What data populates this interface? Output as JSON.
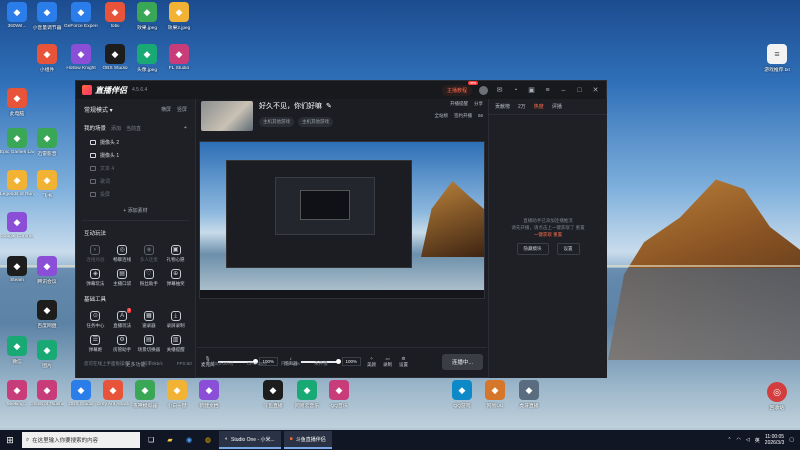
{
  "desktop": {
    "icons_left": [
      {
        "label": "360Wif..."
      },
      {
        "label": "此电脑"
      },
      {
        "label": "Epic Games Launcher"
      },
      {
        "label": "Legends of Runeterra"
      },
      {
        "label": "Google Chrome"
      },
      {
        "label": "Steam"
      },
      {
        "label": "微信"
      },
      {
        "label": "Seeking..."
      }
    ],
    "icons_col2": [
      {
        "label": "小音量调节器"
      },
      {
        "label": "小组件"
      },
      {
        "label": "迅雷影音"
      },
      {
        "label": "飞书"
      },
      {
        "label": "腾讯会议"
      },
      {
        "label": "百度网盘"
      },
      {
        "label": "图片"
      },
      {
        "label": "Ghost of Tsushima"
      }
    ],
    "icons_top": [
      {
        "label": "GeForce Experience"
      },
      {
        "label": "tobii"
      },
      {
        "label": "效果.jpeg"
      },
      {
        "label": "效果2.jpeg"
      },
      {
        "label": "Hollow Knight"
      },
      {
        "label": "OBS Studio"
      },
      {
        "label": "头像.jpeg"
      },
      {
        "label": "FL Studio"
      }
    ],
    "icons_bottom": [
      {
        "label": "OBS Studio"
      },
      {
        "label": "Grey Ant Attack"
      },
      {
        "label": "夜神模拟器"
      },
      {
        "label": "小白一键"
      },
      {
        "label": "新建文档"
      },
      {
        "label": "斗鱼直播"
      },
      {
        "label": "网易云音乐"
      },
      {
        "label": "QQ音乐"
      },
      {
        "label": "QQ游戏"
      },
      {
        "label": "网易UU"
      },
      {
        "label": "虎牙直播"
      }
    ],
    "icon_right_top": {
      "label": "游戏推荐.txt"
    },
    "icon_right_bottom": {
      "label": "回收站"
    }
  },
  "app": {
    "brand": "直播伴侣",
    "version": "4.5.6.4",
    "hot_label": "主播教程",
    "hot_tag": "new",
    "left": {
      "mode_label": "常规模式 ▾",
      "mode_options": [
        "横屏",
        "竖屏"
      ],
      "scenes_title": "我的场景",
      "scenes_sub": [
        "添加",
        "当前直"
      ],
      "scenes": [
        {
          "label": "摄像头 2",
          "dim": false
        },
        {
          "label": "摄像头 1",
          "dim": false
        },
        {
          "label": "文本 4",
          "dim": true
        },
        {
          "label": "歌词",
          "dim": true
        },
        {
          "label": "投屏",
          "dim": true
        }
      ],
      "add_source": "+ 添加素材",
      "interact_title": "互动玩法",
      "interact": [
        {
          "label": "连线对战",
          "icon": "◐",
          "dim": true
        },
        {
          "label": "畅聊连线",
          "icon": "◎",
          "dim": false
        },
        {
          "label": "多人连麦",
          "icon": "◉",
          "dim": true
        },
        {
          "label": "礼物心愿",
          "icon": "▣",
          "dim": false
        },
        {
          "label": "弹幕玩法",
          "icon": "◈",
          "dim": false
        },
        {
          "label": "主播口袋",
          "icon": "▤",
          "dim": false
        },
        {
          "label": "粉丝助手",
          "icon": "♡",
          "dim": false
        },
        {
          "label": "弹幕抽奖",
          "icon": "⊕",
          "dim": false
        }
      ],
      "tools_title": "基础工具",
      "tools": [
        {
          "label": "任务中心",
          "icon": "⊙",
          "badge": ""
        },
        {
          "label": "直播玩法",
          "icon": "A",
          "badge": "1"
        },
        {
          "label": "速录器",
          "icon": "▦",
          "badge": ""
        },
        {
          "label": "录屏录制",
          "icon": "⤓",
          "badge": ""
        },
        {
          "label": "弹幕姬",
          "icon": "☰",
          "badge": ""
        },
        {
          "label": "房管助手",
          "icon": "⚙",
          "badge": ""
        },
        {
          "label": "场景切换器",
          "icon": "▤",
          "badge": ""
        },
        {
          "label": "关播提醒",
          "icon": "▥",
          "badge": ""
        }
      ],
      "more": "更多功能"
    },
    "main": {
      "stream_title": "好久不见，你们好嘛",
      "tags": [
        "主机其他游戏",
        "主机其他游戏"
      ],
      "meta_top": [
        "开播提醒",
        "分享"
      ],
      "meta_bottom": [
        "全站榜",
        "签约开播",
        "56"
      ],
      "audio": {
        "mic_label": "麦克风",
        "mic_pct": "100%",
        "mic_level": 1.0,
        "speaker_label": "扬声器",
        "speaker_pct": "100%",
        "speaker_level": 1.0
      },
      "tools": [
        "美颜",
        "录制",
        "设置"
      ],
      "live_button": "连播中...",
      "status": [
        "您可在线上手面板操作",
        "码率0kb/s",
        "FPS:60",
        "丢帧0(0.00%)",
        "CPU:15%",
        "内存:17%",
        "未开播"
      ]
    },
    "right": {
      "tabs": [
        "贡献榜",
        "2万",
        "热度",
        "评播"
      ],
      "active_tab": 2,
      "note_line1": "直播助手已添加连播推流",
      "note_line2": "请先开播，请点击上一键获取了 重置",
      "link": "一键获取",
      "link2": "重置",
      "btn1": "隐藏模块",
      "btn2": "设置"
    }
  },
  "taskbar": {
    "search_placeholder": "在这里输入你要搜索的内容",
    "apps": [
      {
        "label": "Studio One - 小米..."
      },
      {
        "label": "斗鱼直播伴侣"
      }
    ],
    "tray_text": "英",
    "time": "11:00:05",
    "date": "2026/3/3"
  }
}
